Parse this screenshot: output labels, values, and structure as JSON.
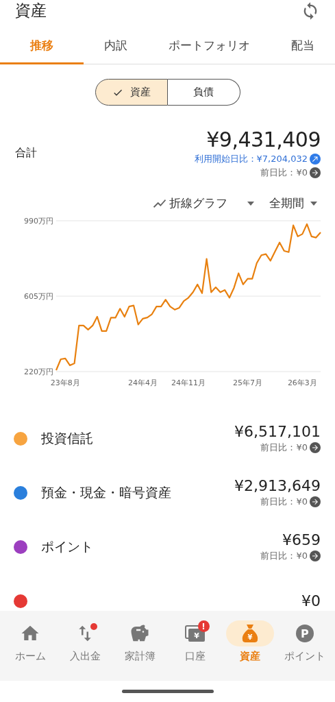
{
  "header": {
    "title": "資産"
  },
  "tabs": [
    {
      "label": "推移",
      "selected": true
    },
    {
      "label": "内訳",
      "selected": false
    },
    {
      "label": "ポートフォリオ",
      "selected": false
    },
    {
      "label": "配当",
      "selected": false
    }
  ],
  "toggle": [
    {
      "label": "資産",
      "selected": true
    },
    {
      "label": "負債",
      "selected": false
    }
  ],
  "summary": {
    "label": "合計",
    "total": "¥9,431,409",
    "since_start": "利用開始日比：¥7,204,032",
    "day_change": "前日比：¥0"
  },
  "chart_controls": {
    "chart_type": "折線グラフ",
    "period": "全期間"
  },
  "chart_data": {
    "type": "line",
    "categories": [
      null,
      null,
      "23年8月",
      null,
      null,
      null,
      null,
      null,
      null,
      null,
      null,
      null,
      null,
      null,
      null,
      null,
      null,
      null,
      null,
      "24年4月",
      null,
      null,
      null,
      null,
      null,
      null,
      null,
      null,
      null,
      "24年11月",
      null,
      null,
      null,
      null,
      null,
      null,
      null,
      null,
      null,
      null,
      null,
      null,
      "25年7月",
      null,
      null,
      null,
      null,
      null,
      null,
      null,
      null,
      null,
      null,
      null,
      "26年3月",
      null,
      null,
      null,
      null
    ],
    "series": [
      {
        "color": "#e8800f",
        "values": [
          227,
          283,
          287,
          252,
          262,
          455,
          455,
          434,
          455,
          500,
          427,
          427,
          495,
          495,
          541,
          500,
          552,
          557,
          460,
          490,
          496,
          513,
          552,
          552,
          587,
          552,
          536,
          546,
          580,
          597,
          625,
          665,
          620,
          795,
          625,
          650,
          625,
          636,
          597,
          648,
          722,
          665,
          694,
          694,
          774,
          814,
          820,
          786,
          833,
          879,
          836,
          830,
          967,
          910,
          922,
          973,
          910,
          904,
          930
        ]
      }
    ],
    "ylim": [
      220,
      990
    ],
    "yticks": [
      {
        "value": 220,
        "label": "220万円"
      },
      {
        "value": 605,
        "label": "605万円"
      },
      {
        "value": 990,
        "label": "990万円"
      }
    ]
  },
  "assets": [
    {
      "name": "投資信託",
      "value": "¥6,517,101",
      "day_change": "前日比：¥0",
      "color": "#f7a440"
    },
    {
      "name": "預金・現金・暗号資産",
      "value": "¥2,913,649",
      "day_change": "前日比：¥0",
      "color": "#2a7fdc"
    },
    {
      "name": "ポイント",
      "value": "¥659",
      "day_change": "前日比：¥0",
      "color": "#9c3fbf"
    },
    {
      "value": "¥0",
      "color": "#e53935"
    }
  ],
  "nav": [
    {
      "label": "ホーム",
      "kind": "home",
      "selected": false,
      "dot": false
    },
    {
      "label": "入出金",
      "kind": "transfer",
      "selected": false,
      "dot": true
    },
    {
      "label": "家計簿",
      "kind": "piggy",
      "selected": false,
      "dot": false
    },
    {
      "label": "口座",
      "kind": "wallet",
      "icon_text": "¥",
      "badge": "!",
      "selected": false,
      "dot": false
    },
    {
      "label": "資産",
      "kind": "bag",
      "icon_text": "¥",
      "selected": true,
      "dot": false
    },
    {
      "label": "ポイント",
      "kind": "coin",
      "icon_text": "P",
      "selected": false,
      "dot": false
    }
  ]
}
